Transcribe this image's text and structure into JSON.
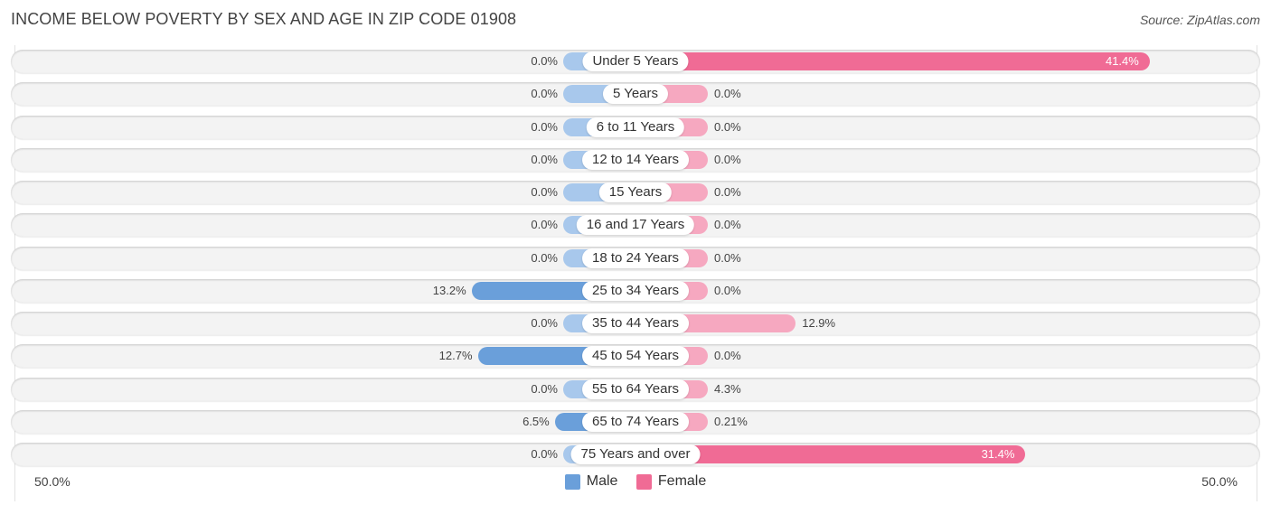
{
  "title": "INCOME BELOW POVERTY BY SEX AND AGE IN ZIP CODE 01908",
  "source": "Source: ZipAtlas.com",
  "colors": {
    "male_strong": "#6a9fda",
    "male_light": "#a8c8ec",
    "female_strong": "#f06b95",
    "female_light": "#f6a8c0"
  },
  "chart_data": {
    "type": "bar",
    "orientation": "horizontal-diverging",
    "title": "INCOME BELOW POVERTY BY SEX AND AGE IN ZIP CODE 01908",
    "categories": [
      "Under 5 Years",
      "5 Years",
      "6 to 11 Years",
      "12 to 14 Years",
      "15 Years",
      "16 and 17 Years",
      "18 to 24 Years",
      "25 to 34 Years",
      "35 to 44 Years",
      "45 to 54 Years",
      "55 to 64 Years",
      "65 to 74 Years",
      "75 Years and over"
    ],
    "series": [
      {
        "name": "Male",
        "values": [
          0.0,
          0.0,
          0.0,
          0.0,
          0.0,
          0.0,
          0.0,
          13.2,
          0.0,
          12.7,
          0.0,
          6.5,
          0.0
        ],
        "labels": [
          "0.0%",
          "0.0%",
          "0.0%",
          "0.0%",
          "0.0%",
          "0.0%",
          "0.0%",
          "13.2%",
          "0.0%",
          "12.7%",
          "0.0%",
          "6.5%",
          "0.0%"
        ]
      },
      {
        "name": "Female",
        "values": [
          41.4,
          0.0,
          0.0,
          0.0,
          0.0,
          0.0,
          0.0,
          0.0,
          12.9,
          0.0,
          4.3,
          0.21,
          31.4
        ],
        "labels": [
          "41.4%",
          "0.0%",
          "0.0%",
          "0.0%",
          "0.0%",
          "0.0%",
          "0.0%",
          "0.0%",
          "12.9%",
          "0.0%",
          "4.3%",
          "0.21%",
          "31.4%"
        ]
      }
    ],
    "xlim": [
      -50,
      50
    ],
    "axis_labels": {
      "left": "50.0%",
      "right": "50.0%"
    },
    "legend": [
      "Male",
      "Female"
    ],
    "legend_position": "bottom-center",
    "unit": "%"
  }
}
